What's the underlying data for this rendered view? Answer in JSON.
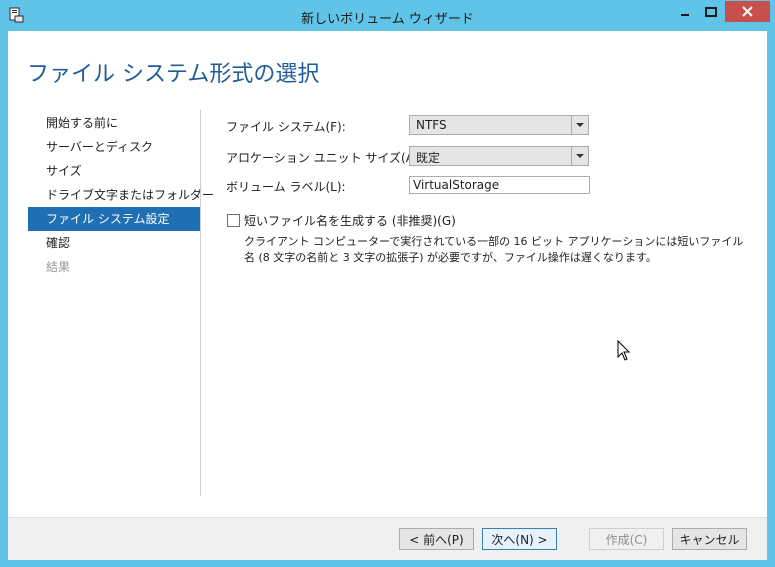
{
  "window": {
    "title": "新しいボリューム ウィザード",
    "app_icon": "wizard-icon",
    "minimize_icon": "minimize-icon",
    "maximize_icon": "maximize-icon",
    "close_icon": "close-icon",
    "close_color": "#c7504c"
  },
  "page": {
    "title": "ファイル システム形式の選択"
  },
  "sidebar": {
    "steps": [
      {
        "label": "開始する前に",
        "state": "normal"
      },
      {
        "label": "サーバーとディスク",
        "state": "normal"
      },
      {
        "label": "サイズ",
        "state": "normal"
      },
      {
        "label": "ドライブ文字またはフォルダー",
        "state": "normal"
      },
      {
        "label": "ファイル システム設定",
        "state": "active"
      },
      {
        "label": "確認",
        "state": "normal"
      },
      {
        "label": "結果",
        "state": "disabled"
      }
    ],
    "active_color": "#1f6fb5"
  },
  "form": {
    "filesystem_label": "ファイル システム(F):",
    "filesystem_value": "NTFS",
    "allocation_label": "アロケーション ユニット サイズ(A):",
    "allocation_value": "既定",
    "volume_label_label": "ボリューム ラベル(L):",
    "volume_label_value": "VirtualStorage",
    "short_names_label": "短いファイル名を生成する (非推奨)(G)",
    "short_names_checked": false,
    "description": "クライアント コンピューターで実行されている一部の 16 ビット アプリケーションには短いファイル名 (8 文字の名前と 3 文字の拡張子) が必要ですが、ファイル操作は遅くなります。"
  },
  "footer": {
    "back_label": "< 前へ(P)",
    "next_label": "次へ(N) >",
    "create_label": "作成(C)",
    "cancel_label": "キャンセル"
  },
  "accent_title_color": "#1e5c9a",
  "titlebar_color": "#5fc4e8"
}
